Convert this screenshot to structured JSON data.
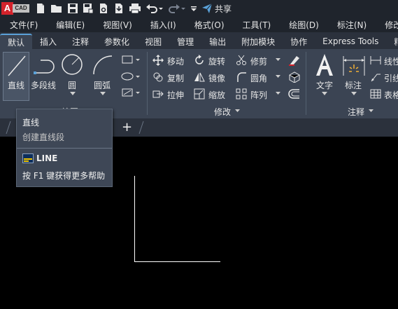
{
  "app": {
    "logo_letter": "A",
    "logo_text": "CAD",
    "share_label": "共享"
  },
  "menu": [
    "文件(F)",
    "编辑(E)",
    "视图(V)",
    "插入(I)",
    "格式(O)",
    "工具(T)",
    "绘图(D)",
    "标注(N)",
    "修改(M)"
  ],
  "tabs": [
    "默认",
    "插入",
    "注释",
    "参数化",
    "视图",
    "管理",
    "输出",
    "附加模块",
    "协作",
    "Express Tools",
    "精选"
  ],
  "draw": {
    "line": "直线",
    "polyline": "多段线",
    "circle": "圆",
    "arc": "圆弧",
    "panel_title": "绘图"
  },
  "modify": {
    "move": "移动",
    "rotate": "旋转",
    "trim": "修剪",
    "copy": "复制",
    "mirror": "镜像",
    "fillet": "圆角",
    "stretch": "拉伸",
    "scale": "缩放",
    "array": "阵列",
    "panel_title": "修改"
  },
  "annotation": {
    "text": "文字",
    "dimension": "标注",
    "linear": "线性",
    "leader": "引线",
    "table": "表格",
    "panel_title": "注释"
  },
  "tooltip": {
    "title": "直线",
    "desc": "创建直线段",
    "command": "LINE",
    "help": "按 F1 键获得更多帮助"
  },
  "doctab": {
    "add": "+"
  },
  "colors": {
    "accent": "#5aa1d8",
    "ribbon_bg": "#3b4453",
    "tabs_bg": "#2b313c",
    "titlebar_bg": "#1f242c",
    "logo_red": "#d3222b"
  }
}
